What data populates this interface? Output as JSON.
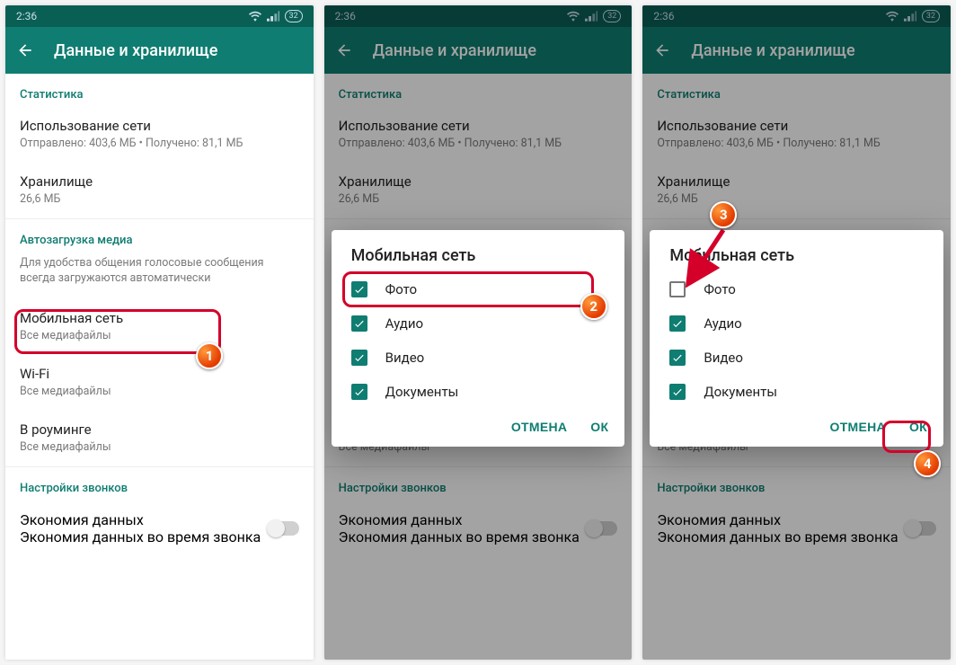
{
  "status": {
    "time": "2:36",
    "battery": "32"
  },
  "header": {
    "title": "Данные и хранилище"
  },
  "sections": {
    "stats": {
      "label": "Статистика",
      "network": {
        "title": "Использование сети",
        "sub": "Отправлено: 403,6 МБ • Получено: 81,1 МБ"
      },
      "storage": {
        "title": "Хранилище",
        "sub": "26,6 МБ"
      }
    },
    "autodl": {
      "label": "Автозагрузка медиа",
      "desc": "Для удобства общения голосовые сообщения всегда загружаются автоматически",
      "mobile": {
        "title": "Мобильная сеть",
        "sub": "Все медиафайлы"
      },
      "wifi": {
        "title": "Wi-Fi",
        "sub": "Все медиафайлы"
      },
      "roaming": {
        "title": "В роуминге",
        "sub": "Все медиафайлы"
      }
    },
    "calls": {
      "label": "Настройки звонков",
      "saver": {
        "title": "Экономия данных",
        "sub": "Экономия данных во время звонка"
      }
    }
  },
  "dialog": {
    "title": "Мобильная сеть",
    "options": {
      "photo": "Фото",
      "audio": "Аудио",
      "video": "Видео",
      "docs": "Документы"
    },
    "cancel": "ОТМЕНА",
    "ok": "ОК"
  },
  "markers": {
    "m1": "1",
    "m2": "2",
    "m3": "3",
    "m4": "4"
  }
}
